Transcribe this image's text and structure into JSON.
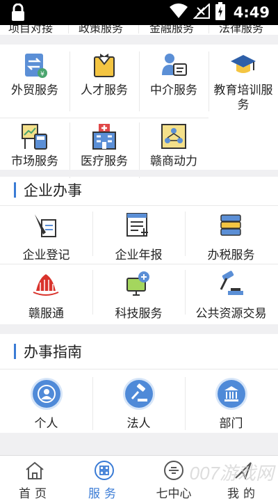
{
  "status_bar": {
    "time": "4:49"
  },
  "cut_row": {
    "items": [
      "项目对接",
      "政策服务",
      "金融服务",
      "法律服务"
    ]
  },
  "services": {
    "items": [
      {
        "label": "外贸服务",
        "icon": "trade-icon"
      },
      {
        "label": "人才服务",
        "icon": "talent-icon"
      },
      {
        "label": "中介服务",
        "icon": "agency-icon"
      },
      {
        "label": "教育培训服务",
        "icon": "education-icon"
      },
      {
        "label": "市场服务",
        "icon": "market-icon"
      },
      {
        "label": "医疗服务",
        "icon": "hospital-icon"
      },
      {
        "label": "赣商动力",
        "icon": "merchant-icon"
      }
    ]
  },
  "enterprise": {
    "title": "企业办事",
    "items": [
      {
        "label": "企业登记",
        "icon": "register-icon"
      },
      {
        "label": "企业年报",
        "icon": "annual-report-icon"
      },
      {
        "label": "办税服务",
        "icon": "tax-icon"
      },
      {
        "label": "赣服通",
        "icon": "ganfutong-icon"
      },
      {
        "label": "科技服务",
        "icon": "tech-icon"
      },
      {
        "label": "公共资源交易",
        "icon": "auction-icon"
      }
    ]
  },
  "guide": {
    "title": "办事指南",
    "items": [
      {
        "label": "个人",
        "icon": "person-icon"
      },
      {
        "label": "法人",
        "icon": "gavel-icon"
      },
      {
        "label": "部门",
        "icon": "building-icon"
      }
    ]
  },
  "tabbar": {
    "tabs": [
      {
        "label": "首页",
        "icon": "home-icon"
      },
      {
        "label": "服务",
        "icon": "service-icon",
        "active": true
      },
      {
        "label": "七中心",
        "icon": "center-icon"
      },
      {
        "label": "我的",
        "icon": "profile-icon"
      }
    ]
  },
  "watermark": "007游戏网",
  "colors": {
    "accent": "#3a7bd5",
    "gap": "#f0f0f2",
    "guide_circle": "#4f8ad8"
  }
}
